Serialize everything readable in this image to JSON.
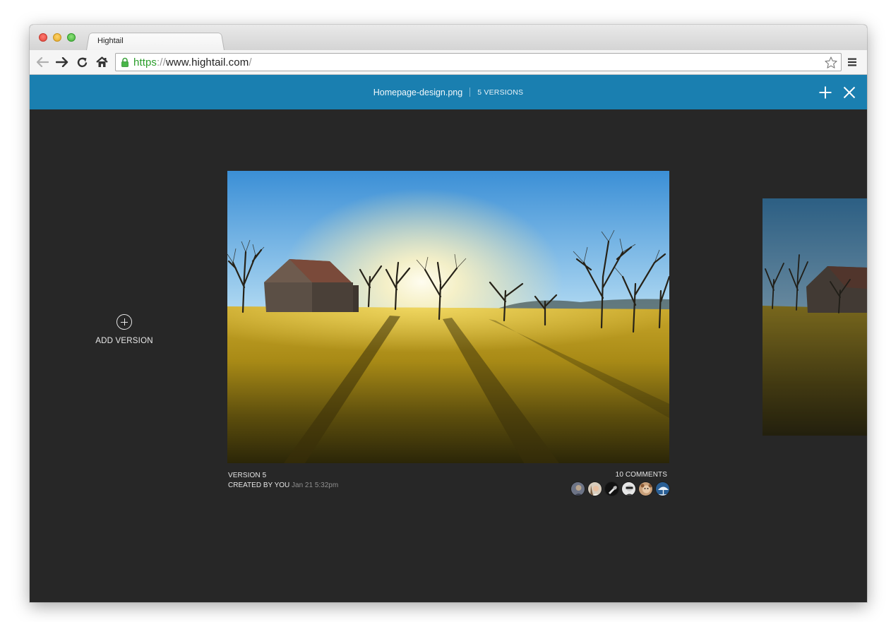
{
  "browser": {
    "tab_title": "Hightail",
    "url": {
      "scheme": "https",
      "separator": "://",
      "host": "www.hightail.com",
      "path": "/"
    }
  },
  "header": {
    "file_name": "Homepage-design.png",
    "versions_count": "5 VERSIONS",
    "accent_color": "#1a7fb0"
  },
  "sidebar": {
    "add_version_label": "ADD VERSION"
  },
  "version_card": {
    "version_label": "VERSION 5",
    "created_by": "CREATED BY YOU",
    "created_date": "Jan 21 5:32pm",
    "comments_label": "10 COMMENTS",
    "avatars": [
      "avatar-1",
      "avatar-2",
      "avatar-3",
      "avatar-4",
      "avatar-5",
      "avatar-6"
    ]
  }
}
